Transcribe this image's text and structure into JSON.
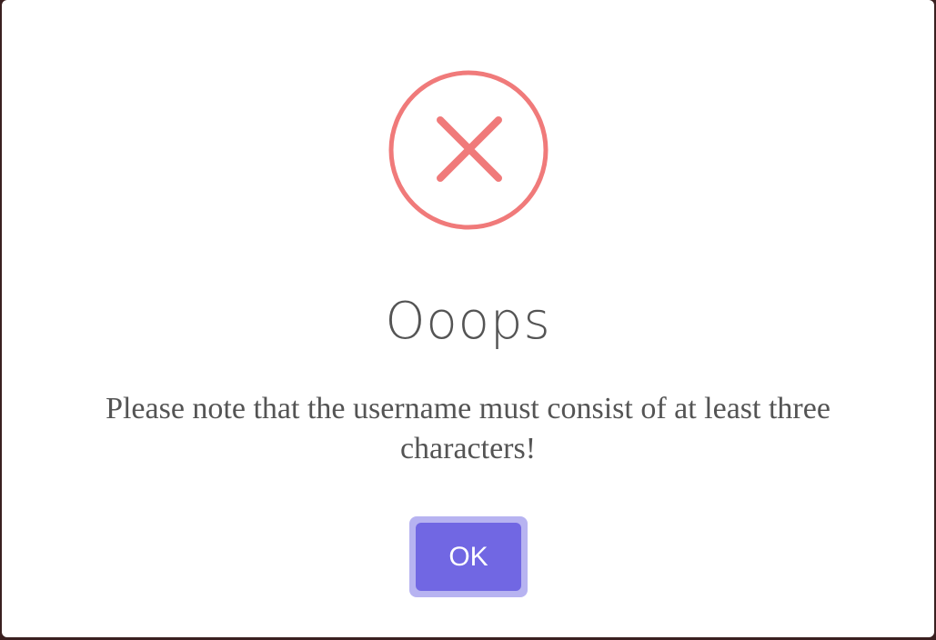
{
  "dialog": {
    "icon": "error-x-icon",
    "title": "Ooops",
    "message": "Please note that the username must consist of at least three characters!",
    "confirm_label": "OK"
  },
  "colors": {
    "error_icon": "#f07a7a",
    "title_text": "#545454",
    "button": "#7167e3",
    "button_focus_ring": "#b7b3f1",
    "backdrop": "#3a2020"
  }
}
